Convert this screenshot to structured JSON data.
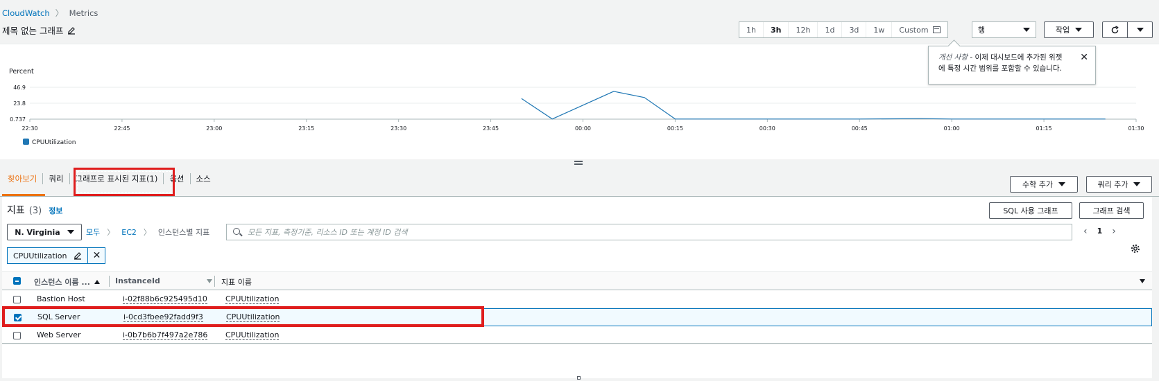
{
  "breadcrumb": {
    "root": "CloudWatch",
    "current": "Metrics"
  },
  "page_title": "제목 없는 그래프",
  "time_range": {
    "options": [
      "1h",
      "3h",
      "12h",
      "1d",
      "3d",
      "1w"
    ],
    "custom_label": "Custom",
    "active": "3h"
  },
  "chart_type_select": "행",
  "action_button": "작업",
  "popover": {
    "emphasis": "개선 사항",
    "line1_rest": " - 이제 대시보드에 추가된 위젯",
    "line2": "에 특정 시간 범위를 포함할 수 있습니다."
  },
  "chart_data": {
    "type": "line",
    "ylabel": "Percent",
    "yticks": [
      "46.9",
      "23.8",
      "0.737"
    ],
    "ylim": [
      0.737,
      46.9
    ],
    "xticks": [
      "22:30",
      "22:45",
      "23:00",
      "23:15",
      "23:30",
      "23:45",
      "00:00",
      "00:15",
      "00:30",
      "00:45",
      "01:00",
      "01:15",
      "01:30"
    ],
    "series": [
      {
        "name": "CPUUtilization",
        "color": "#1f77b4",
        "x": [
          "23:50",
          "23:55",
          "00:05",
          "00:10",
          "00:15",
          "00:30",
          "00:45",
          "00:55",
          "01:00",
          "01:15",
          "01:25"
        ],
        "values": [
          30.5,
          0.9,
          41.0,
          32.0,
          0.9,
          0.9,
          0.9,
          1.5,
          0.9,
          0.9,
          0.9
        ]
      }
    ],
    "legend": "bottom-left",
    "grid": true
  },
  "tabs": [
    {
      "label": "찾아보기",
      "active": true
    },
    {
      "label": "쿼리",
      "active": false
    },
    {
      "label": "그래프로 표시된 지표(1)",
      "active": false
    },
    {
      "label": "옵션",
      "active": false
    },
    {
      "label": "소스",
      "active": false
    }
  ],
  "add_math_button": "수학 추가",
  "add_query_button": "쿼리 추가",
  "metrics": {
    "title": "지표",
    "count": "(3)",
    "info": "정보",
    "sql_button": "SQL 사용 그래프",
    "graph_search_button": "그래프 검색",
    "region": "N. Virginia",
    "namespace": {
      "all": "모두",
      "ec2": "EC2",
      "current": "인스턴스별 지표"
    },
    "search_placeholder": "모든 지표, 측정기준, 리소스 ID 또는 계정 ID 검색",
    "page": "1",
    "filter_token": "CPUUtilization",
    "columns": [
      "인스턴스 이름 ...",
      "InstanceId",
      "지표 이름"
    ],
    "rows": [
      {
        "name": "Bastion Host",
        "id": "i-02f88b6c925495d10",
        "metric": "CPUUtilization",
        "checked": false
      },
      {
        "name": "SQL Server",
        "id": "i-0cd3fbee92fadd9f3",
        "metric": "CPUUtilization",
        "checked": true
      },
      {
        "name": "Web Server",
        "id": "i-0b7b6b7f497a2e786",
        "metric": "CPUUtilization",
        "checked": false
      }
    ]
  }
}
